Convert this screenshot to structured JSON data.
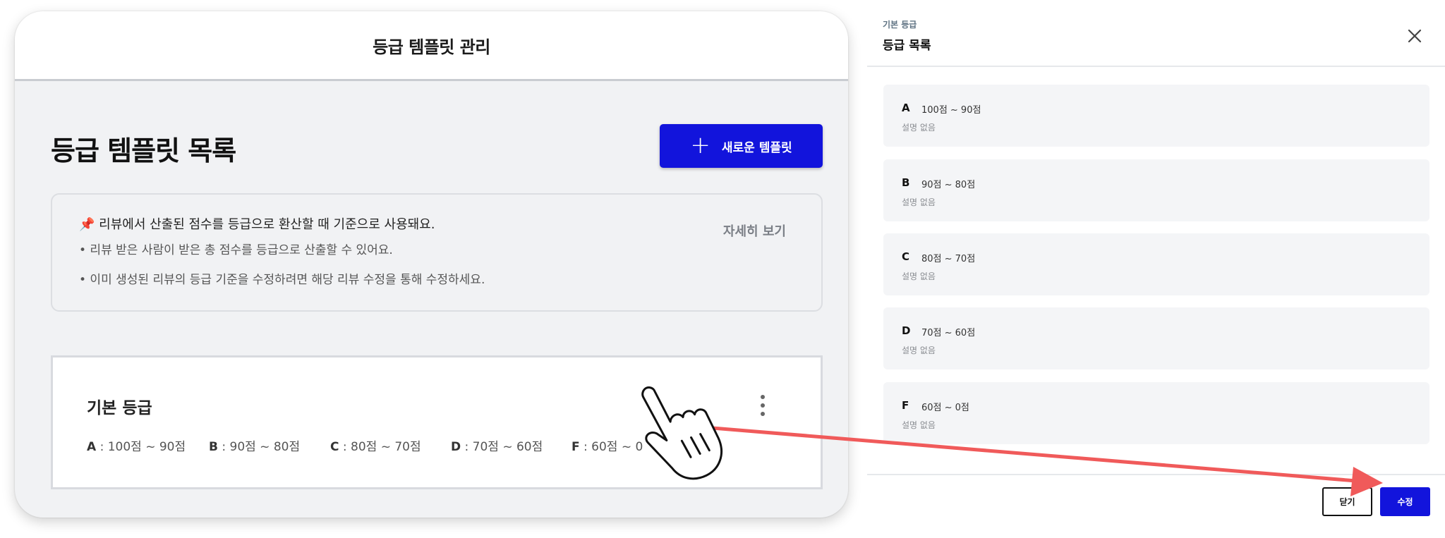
{
  "left": {
    "header_title": "등급 템플릿 관리",
    "list_heading": "등급 템플릿 목록",
    "new_button": {
      "icon": "plus-icon",
      "label": "새로운 템플릿"
    },
    "info": {
      "main": "📌 리뷰에서 산출된 점수를 등급으로 환산할 때 기준으로 사용돼요.",
      "bullets": [
        "• 리뷰 받은 사람이 받은 총 점수를 등급으로 산출할 수 있어요.",
        "• 이미 생성된 리뷰의 등급 기준을 수정하려면 해당 리뷰 수정을 통해 수정하세요."
      ],
      "more_link": "자세히 보기"
    },
    "card": {
      "title": "기본 등급",
      "ranges": [
        {
          "grade": "A",
          "text": " : 100점 ~ 90점"
        },
        {
          "grade": "B",
          "text": " : 90점 ~ 80점"
        },
        {
          "grade": "C",
          "text": " : 80점 ~ 70점"
        },
        {
          "grade": "D",
          "text": " : 70점 ~ 60점"
        },
        {
          "grade": "F",
          "text": " : 60점 ~ 0"
        }
      ]
    }
  },
  "panel": {
    "subtitle": "기본 등급",
    "title": "등급 목록",
    "items": [
      {
        "letter": "A",
        "range": "100점 ~ 90점",
        "desc": "설명 없음"
      },
      {
        "letter": "B",
        "range": "90점 ~ 80점",
        "desc": "설명 없음"
      },
      {
        "letter": "C",
        "range": "80점 ~ 70점",
        "desc": "설명 없음"
      },
      {
        "letter": "D",
        "range": "70점 ~ 60점",
        "desc": "설명 없음"
      },
      {
        "letter": "F",
        "range": "60점 ~ 0점",
        "desc": "설명 없음"
      }
    ],
    "close_button": "닫기",
    "edit_button": "수정"
  },
  "colors": {
    "primary": "#1214dc",
    "annotation_arrow": "#f05a5a"
  }
}
